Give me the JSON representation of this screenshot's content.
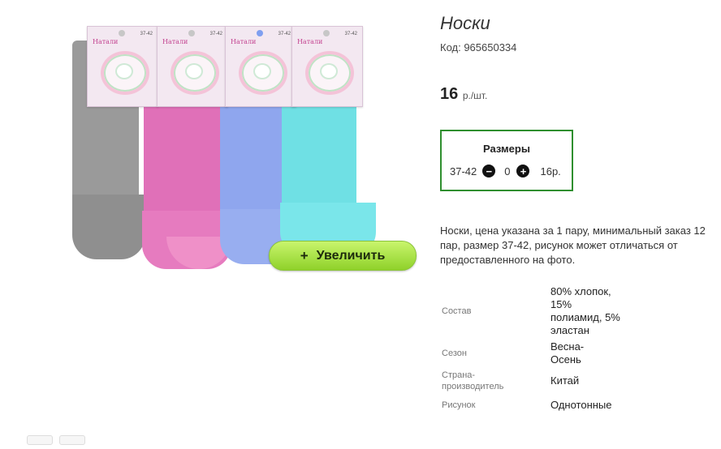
{
  "product": {
    "title": "Носки",
    "code_label": "Код: 965650334",
    "price": "16",
    "price_unit": "р./шт."
  },
  "zoom_button": {
    "icon": "plus-icon",
    "label": "Увеличить"
  },
  "packaging": {
    "brand": "Натали",
    "size": "37-42"
  },
  "sizes": {
    "heading": "Размеры",
    "rows": [
      {
        "size": "37-42",
        "quantity": "0",
        "price": "16р."
      }
    ]
  },
  "description": "Носки, цена указана за 1 пару, минимальный заказ 12 пар, размер 37-42, рисунок может отличаться от предоставленного на фото.",
  "properties": [
    {
      "label": "Состав",
      "value": "80% хлопок, 15% полиамид, 5% эластан"
    },
    {
      "label": "Сезон",
      "value": "Весна-Осень"
    },
    {
      "label": "Страна-производитель",
      "value": "Китай"
    },
    {
      "label": "Рисунок",
      "value": "Однотонные"
    }
  ],
  "colors": {
    "sizes_border": "#2f8f2f",
    "zoom_button": "#a8e04a"
  }
}
